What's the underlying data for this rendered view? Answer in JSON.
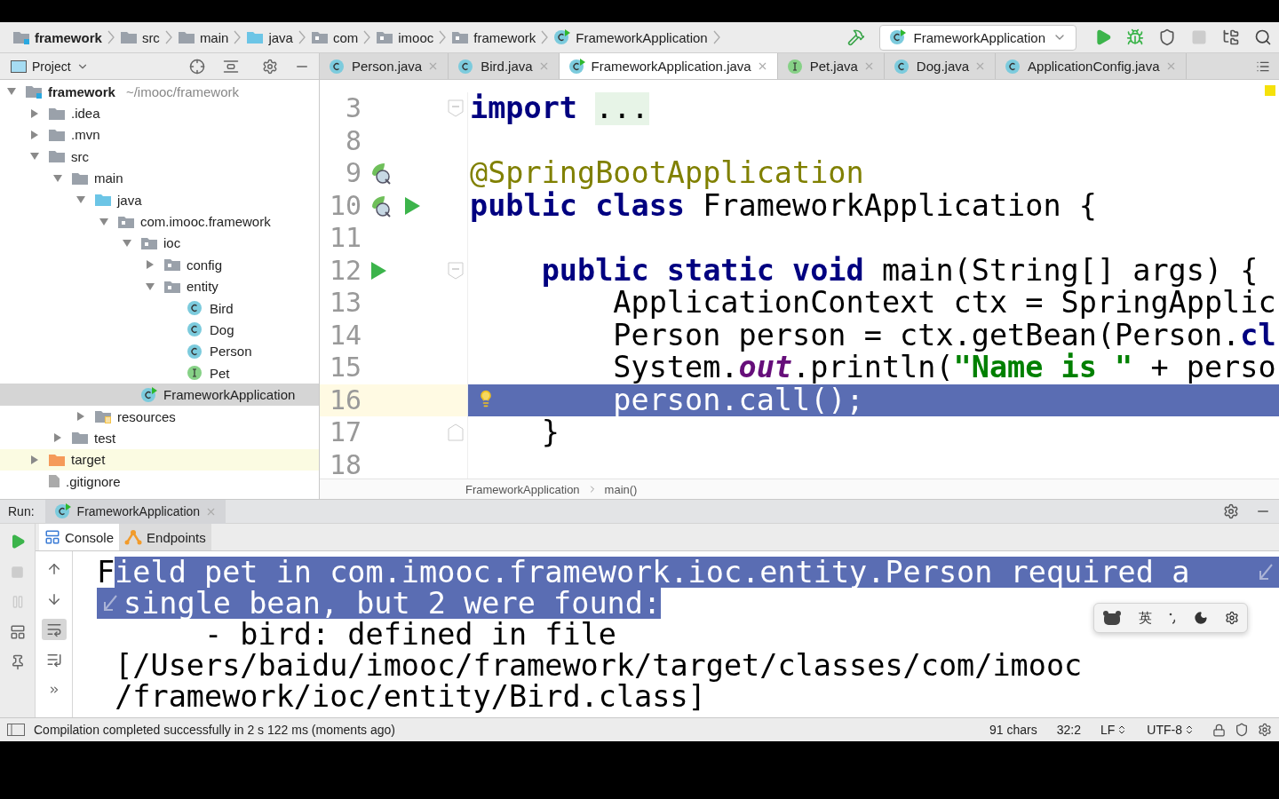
{
  "nav_breadcrumbs": [
    {
      "label": "framework",
      "kind": "module"
    },
    {
      "label": "src",
      "kind": "folder"
    },
    {
      "label": "main",
      "kind": "folder"
    },
    {
      "label": "java",
      "kind": "source_folder"
    },
    {
      "label": "com",
      "kind": "package"
    },
    {
      "label": "imooc",
      "kind": "package"
    },
    {
      "label": "framework",
      "kind": "package"
    },
    {
      "label": "FrameworkApplication",
      "kind": "app"
    }
  ],
  "run_config": {
    "label": "FrameworkApplication"
  },
  "project_panel": {
    "title": "Project"
  },
  "editor_tabs": [
    {
      "label": "Person.java",
      "kind": "class",
      "selected": false
    },
    {
      "label": "Bird.java",
      "kind": "class",
      "selected": false
    },
    {
      "label": "FrameworkApplication.java",
      "kind": "app",
      "selected": true
    },
    {
      "label": "Pet.java",
      "kind": "interface",
      "selected": false
    },
    {
      "label": "Dog.java",
      "kind": "class",
      "selected": false
    },
    {
      "label": "ApplicationConfig.java",
      "kind": "class",
      "selected": false
    }
  ],
  "project_tree": [
    {
      "label": "framework",
      "path": "~/imooc/framework",
      "kind": "module",
      "expanded": true,
      "selected": false,
      "children": [
        {
          "label": ".idea",
          "kind": "folder",
          "expanded": false,
          "selected": false
        },
        {
          "label": ".mvn",
          "kind": "folder",
          "expanded": false,
          "selected": false
        },
        {
          "label": "src",
          "kind": "folder",
          "expanded": true,
          "selected": false,
          "children": [
            {
              "label": "main",
              "kind": "folder",
              "expanded": true,
              "selected": false,
              "children": [
                {
                  "label": "java",
                  "kind": "source_folder",
                  "expanded": true,
                  "selected": false,
                  "children": [
                    {
                      "label": "com.imooc.framework",
                      "kind": "package",
                      "expanded": true,
                      "selected": false,
                      "children": [
                        {
                          "label": "ioc",
                          "kind": "package",
                          "expanded": true,
                          "selected": false,
                          "children": [
                            {
                              "label": "config",
                              "kind": "package",
                              "expanded": false,
                              "selected": false
                            },
                            {
                              "label": "entity",
                              "kind": "package",
                              "expanded": true,
                              "selected": false,
                              "children": [
                                {
                                  "label": "Bird",
                                  "kind": "class",
                                  "selected": false
                                },
                                {
                                  "label": "Dog",
                                  "kind": "class",
                                  "selected": false
                                },
                                {
                                  "label": "Person",
                                  "kind": "class",
                                  "selected": false
                                },
                                {
                                  "label": "Pet",
                                  "kind": "interface",
                                  "selected": false
                                }
                              ]
                            }
                          ]
                        },
                        {
                          "label": "FrameworkApplication",
                          "kind": "app",
                          "selected": true
                        }
                      ]
                    }
                  ]
                },
                {
                  "label": "resources",
                  "kind": "resources",
                  "expanded": false,
                  "selected": false
                }
              ]
            },
            {
              "label": "test",
              "kind": "folder",
              "expanded": false,
              "selected": false
            }
          ]
        },
        {
          "label": "target",
          "kind": "excluded",
          "expanded": false,
          "selected": false
        },
        {
          "label": ".gitignore",
          "kind": "file",
          "selected": false
        }
      ]
    }
  ],
  "editor": {
    "lines": [
      {
        "number": "3",
        "fold_start": true,
        "current": false,
        "tokens": [
          {
            "t": "import ",
            "kind": "keyword"
          },
          {
            "t": "...",
            "kind": "folded"
          }
        ]
      },
      {
        "number": "8",
        "current": false
      },
      {
        "number": "9",
        "markers": [
          {
            "kind": "bean"
          }
        ],
        "current": false,
        "tokens": [
          {
            "t": "@SpringBootApplication",
            "kind": "annotation"
          }
        ]
      },
      {
        "number": "10",
        "markers": [
          {
            "kind": "bean"
          },
          {
            "kind": "run"
          }
        ],
        "current": false,
        "tokens": [
          {
            "t": "public class ",
            "kind": "keyword"
          },
          {
            "t": "FrameworkApplication {",
            "kind": "plain"
          }
        ]
      },
      {
        "number": "11",
        "current": false
      },
      {
        "number": "12",
        "fold_start": true,
        "markers": [
          {
            "kind": "run"
          }
        ],
        "current": false,
        "tokens": [
          {
            "t": "    public static void ",
            "kind": "keyword"
          },
          {
            "t": "main(String[] args) {",
            "kind": "plain"
          }
        ]
      },
      {
        "number": "13",
        "current": false,
        "tokens": [
          {
            "t": "        ApplicationContext ctx = SpringApplic",
            "kind": "plain"
          }
        ]
      },
      {
        "number": "14",
        "current": false,
        "tokens": [
          {
            "t": "        Person person = ctx.getBean(Person.",
            "kind": "plain"
          },
          {
            "t": "cl",
            "kind": "keyword"
          }
        ]
      },
      {
        "number": "15",
        "current": false,
        "tokens": [
          {
            "t": "        System.",
            "kind": "plain"
          },
          {
            "t": "out",
            "kind": "static"
          },
          {
            "t": ".println(",
            "kind": "plain"
          },
          {
            "t": "\"Name is \"",
            "kind": "string"
          },
          {
            "t": " + perso",
            "kind": "plain"
          }
        ]
      },
      {
        "number": "16",
        "current": true,
        "intention": true,
        "tokens": [
          {
            "t": "        person.call();",
            "kind": "plain"
          }
        ]
      },
      {
        "number": "17",
        "fold_end": true,
        "current": false,
        "tokens": [
          {
            "t": "    }",
            "kind": "plain"
          }
        ]
      },
      {
        "number": "18",
        "current": false
      }
    ],
    "breadcrumb": [
      "FrameworkApplication",
      "main()"
    ]
  },
  "run_panel": {
    "label": "Run:",
    "tab": "FrameworkApplication",
    "console_tabs": [
      {
        "label": "Console",
        "kind": "console",
        "selected": true
      },
      {
        "label": "Endpoints",
        "kind": "endpoints",
        "selected": false
      }
    ],
    "console_lines": [
      {
        "segments": [
          {
            "t": "F",
            "selected": false
          },
          {
            "t": "ield pet in com.imooc.framework.ioc.entity.Person required a",
            "selected": true
          }
        ],
        "wrap_end": true
      },
      {
        "segments": [
          {
            "t": "single bean, but 2 were found:",
            "selected": true
          }
        ],
        "wrap_start": true
      },
      {
        "segments": [
          {
            "t": "      - bird: defined in file",
            "selected": false
          }
        ]
      },
      {
        "segments": [
          {
            "t": " [/Users/baidu/imooc/framework/target/classes/com/imooc",
            "selected": false
          }
        ]
      },
      {
        "segments": [
          {
            "t": " /framework/ioc/entity/Bird.class]",
            "selected": false
          }
        ]
      }
    ]
  },
  "ime_toolbar": {
    "mode": "英"
  },
  "status_bar": {
    "message": "Compilation completed successfully in 2 s 122 ms (moments ago)",
    "chars": "91 chars",
    "position": "32:2",
    "line_separator": "LF",
    "encoding": "UTF-8"
  }
}
